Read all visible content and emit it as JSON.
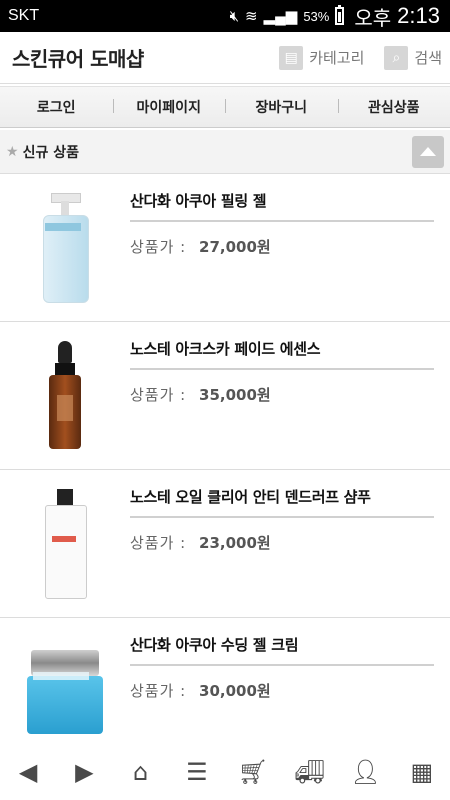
{
  "status_bar": {
    "carrier": "SKT",
    "battery_percent": "53%",
    "ampm": "오후",
    "time": "2:13"
  },
  "header": {
    "title": "스킨큐어 도매샵",
    "category_label": "카테고리",
    "search_label": "검색"
  },
  "nav": {
    "items": [
      "로그인",
      "마이페이지",
      "장바구니",
      "관심상품"
    ]
  },
  "section": {
    "title": "신규 상품"
  },
  "products": [
    {
      "name": "산다화 아쿠아 필링 젤",
      "price_label": "상품가 :",
      "price": "27,000원",
      "image": "pump-bottle"
    },
    {
      "name": "노스테 아크스카 페이드 에센스",
      "price_label": "상품가 :",
      "price": "35,000원",
      "image": "dropper-bottle"
    },
    {
      "name": "노스테 오일 클리어 안티 덴드러프 샴푸",
      "price_label": "상품가 :",
      "price": "23,000원",
      "image": "shampoo-bottle"
    },
    {
      "name": "산다화 아쿠아 수딩 젤 크림",
      "price_label": "상품가 :",
      "price": "30,000원",
      "image": "cream-jar"
    }
  ],
  "bottom_bar": {
    "icons": [
      "back-icon",
      "forward-icon",
      "home-icon",
      "list-icon",
      "cart-icon",
      "delivery-icon",
      "user-icon",
      "grid-icon"
    ]
  }
}
